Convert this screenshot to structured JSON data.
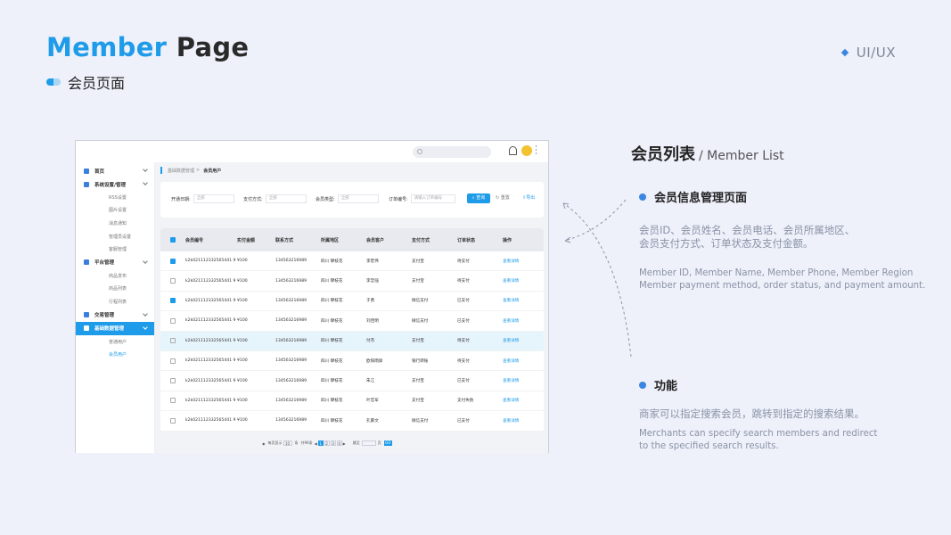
{
  "header": {
    "title_blue": "Member",
    "title_dark": "Page",
    "subtitle": "会员页面",
    "tag": "UI/UX"
  },
  "mock": {
    "sidebar": {
      "items": [
        {
          "label": "首页",
          "icon": "home-icon"
        },
        {
          "label": "系统设置/管理",
          "icon": "settings-icon",
          "subs": [
            "RSS设置",
            "图片设置",
            "消息通知",
            "管理员设置",
            "客服管理"
          ]
        },
        {
          "label": "平台管理",
          "icon": "platform-icon",
          "subs": [
            "商品发布",
            "商品列表",
            "行程列表"
          ]
        },
        {
          "label": "交易管理",
          "icon": "trade-icon"
        },
        {
          "label": "基础数据管理",
          "icon": "chart-icon",
          "subs": [
            "普通用户",
            "会员用户"
          ]
        }
      ]
    },
    "breadcrumb": {
      "parent": "基础数据管理",
      "sep": ">",
      "current": "会员用户"
    },
    "filters": [
      {
        "label": "开通日期:",
        "placeholder": "全部"
      },
      {
        "label": "支付方式:",
        "placeholder": "全部"
      },
      {
        "label": "会员类型:",
        "placeholder": "全部"
      },
      {
        "label": "订单编号:",
        "placeholder": "请输入订单编号"
      }
    ],
    "buttons": {
      "query": "查询",
      "reset": "重置",
      "export": "导出"
    },
    "table": {
      "headers": [
        "会员编号",
        "实付金额",
        "联系方式",
        "所属地区",
        "会员客户",
        "支付方式",
        "订单状态",
        "操作"
      ],
      "rows": [
        {
          "checked": true,
          "id": "k2k021112332565441 9",
          "amount": "¥100",
          "phone": "134563216989",
          "region": "四川 攀枝花",
          "name": "李宏伟",
          "pay": "支付宝",
          "status": "待支付",
          "op": "查看详情"
        },
        {
          "checked": false,
          "id": "k2k021112332565441 9",
          "amount": "¥100",
          "phone": "134563216989",
          "region": "四川 攀枝花",
          "name": "李忠强",
          "pay": "支付宝",
          "status": "待支付",
          "op": "查看详情"
        },
        {
          "checked": true,
          "id": "k2k021112332565441 9",
          "amount": "¥100",
          "phone": "134563216989",
          "region": "四川 攀枝花",
          "name": "于勇",
          "pay": "微信支付",
          "status": "已支付",
          "op": "查看详情"
        },
        {
          "checked": false,
          "id": "k2k021112332565441 9",
          "amount": "¥100",
          "phone": "134563216989",
          "region": "四川 攀枝花",
          "name": "刘佳明",
          "pay": "微信支付",
          "status": "已支付",
          "op": "查看详情"
        },
        {
          "checked": false,
          "id": "k2k021112332565441 9",
          "amount": "¥100",
          "phone": "134563216989",
          "region": "四川 攀枝花",
          "name": "付杰",
          "pay": "支付宝",
          "status": "待支付",
          "op": "查看详情"
        },
        {
          "checked": false,
          "id": "k2k021112332565441 9",
          "amount": "¥100",
          "phone": "134563216989",
          "region": "四川 攀枝花",
          "name": "欧阳雨锋",
          "pay": "银行转账",
          "status": "待支付",
          "op": "查看详情"
        },
        {
          "checked": false,
          "id": "k2k021112332565441 9",
          "amount": "¥100",
          "phone": "134563216989",
          "region": "四川 攀枝花",
          "name": "朱江",
          "pay": "支付宝",
          "status": "已支付",
          "op": "查看详情"
        },
        {
          "checked": false,
          "id": "k2k021112332565441 9",
          "amount": "¥100",
          "phone": "134563216989",
          "region": "四川 攀枝花",
          "name": "叶忠军",
          "pay": "支付宝",
          "status": "支付失败",
          "op": "查看详情"
        },
        {
          "checked": false,
          "id": "k2k021112332565441 9",
          "amount": "¥100",
          "phone": "134563216989",
          "region": "四川 攀枝花",
          "name": "孔繁文",
          "pay": "微信支付",
          "status": "已支付",
          "op": "查看详情"
        }
      ]
    },
    "pager": {
      "per_page_label": "每页显示",
      "per_page": "10",
      "unit": "条",
      "total": "共96条",
      "pages": [
        "1",
        "2",
        "3",
        "4"
      ],
      "jump_label": "跳至",
      "page_unit": "页",
      "go": "GO"
    }
  },
  "panel": {
    "title_zh": "会员列表",
    "title_en": "/ Member List",
    "section1": {
      "title": "会员信息管理页面",
      "zh_line1": "会员ID、会员姓名、会员电话、会员所属地区、",
      "zh_line2": "会员支付方式、订单状态及支付金额。",
      "en_line1": "Member ID, Member Name, Member Phone, Member Region",
      "en_line2": "Member payment method, order status, and payment amount."
    },
    "section2": {
      "title": "功能",
      "zh_line1": "商家可以指定搜索会员，跳转到指定的搜索结果。",
      "en_line1": "Merchants can specify search members and redirect",
      "en_line2": " to the specified search results."
    }
  },
  "colors": {
    "accent": "#1e9be9",
    "bullet": "#3b86e0",
    "background": "#eef0fa"
  }
}
